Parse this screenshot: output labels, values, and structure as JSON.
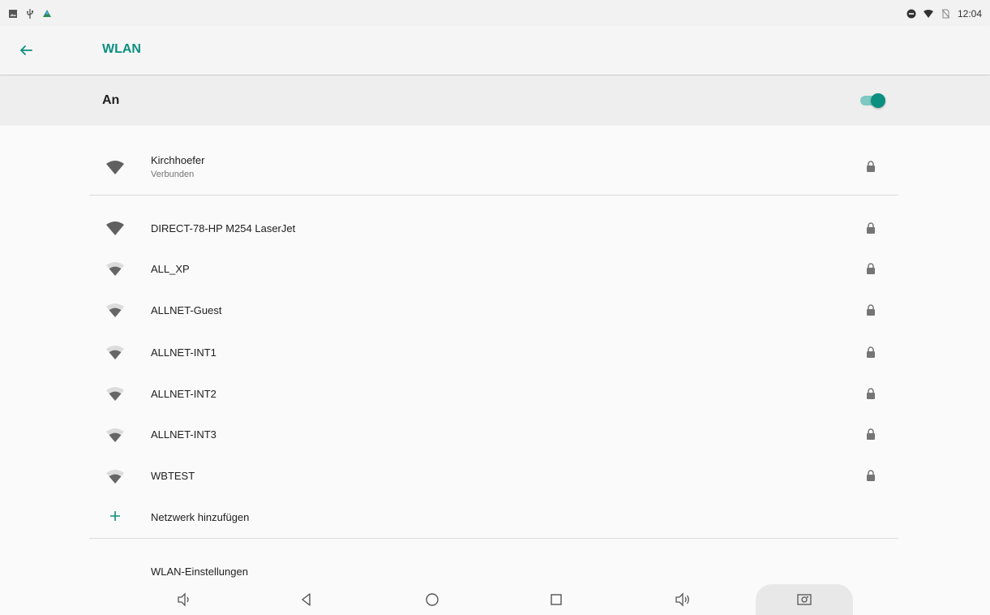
{
  "status_bar": {
    "time": "12:04",
    "left_icons": [
      "image-icon",
      "usb-icon",
      "app-notification-icon"
    ],
    "right_icons": [
      "do-not-disturb-icon",
      "wifi-status-icon",
      "no-sim-icon"
    ]
  },
  "header": {
    "title": "WLAN",
    "accent_color": "#0a8f80"
  },
  "master_switch": {
    "label": "An",
    "checked": true
  },
  "networks": [
    {
      "name": "Kirchhoefer",
      "status": "Verbunden",
      "secured": true,
      "signal": "full"
    },
    {
      "name": "DIRECT-78-HP M254 LaserJet",
      "status": "",
      "secured": true,
      "signal": "full"
    },
    {
      "name": "ALL_XP",
      "status": "",
      "secured": true,
      "signal": "medium"
    },
    {
      "name": "ALLNET-Guest",
      "status": "",
      "secured": true,
      "signal": "medium"
    },
    {
      "name": "ALLNET-INT1",
      "status": "",
      "secured": true,
      "signal": "medium"
    },
    {
      "name": "ALLNET-INT2",
      "status": "",
      "secured": true,
      "signal": "medium"
    },
    {
      "name": "ALLNET-INT3",
      "status": "",
      "secured": true,
      "signal": "medium"
    },
    {
      "name": "WBTEST",
      "status": "",
      "secured": true,
      "signal": "medium"
    }
  ],
  "add_network": {
    "label": "Netzwerk hinzufügen"
  },
  "wlan_settings": {
    "label": "WLAN-Einstellungen"
  },
  "nav_bar": {
    "buttons": [
      "volume-down-icon",
      "back-triangle-icon",
      "home-circle-icon",
      "recents-square-icon",
      "volume-up-icon",
      "screenshot-icon"
    ]
  }
}
